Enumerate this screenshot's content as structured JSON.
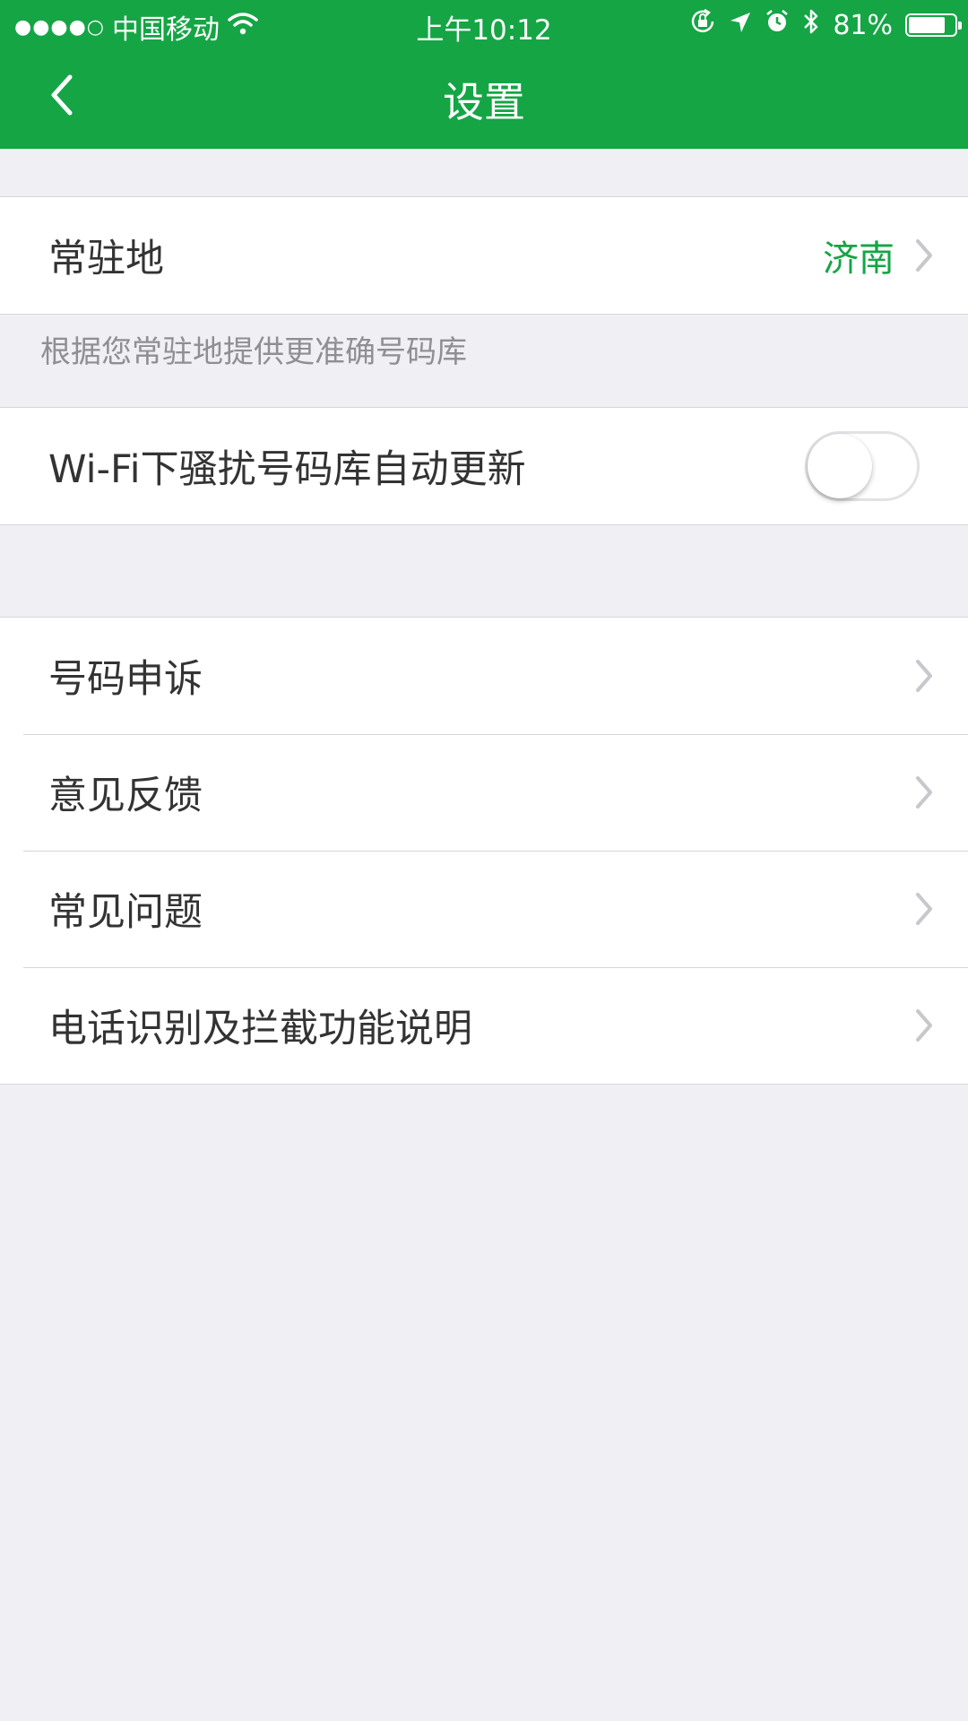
{
  "status_bar": {
    "signal": "●●●●○",
    "carrier": "中国移动",
    "time": "上午10:12",
    "battery": "81%",
    "battery_level": 0.81,
    "icons": [
      "wifi-icon",
      "orientation-lock-icon",
      "location-arrow-icon",
      "alarm-icon",
      "bluetooth-icon",
      "battery-icon"
    ]
  },
  "nav": {
    "title": "设置",
    "back_icon": "chevron-left-icon"
  },
  "colors": {
    "brand_green": "#15a545",
    "background": "#efeff4",
    "separator": "#d6d6da",
    "hint_text": "#8e8e93"
  },
  "section1": {
    "residence": {
      "label": "常驻地",
      "value": "济南"
    },
    "hint": "根据您常驻地提供更准确号码库",
    "wifi_update": {
      "label": "Wi-Fi下骚扰号码库自动更新",
      "enabled": false
    }
  },
  "section2": {
    "items": [
      {
        "label": "号码申诉"
      },
      {
        "label": "意见反馈"
      },
      {
        "label": "常见问题"
      },
      {
        "label": "电话识别及拦截功能说明"
      }
    ]
  }
}
